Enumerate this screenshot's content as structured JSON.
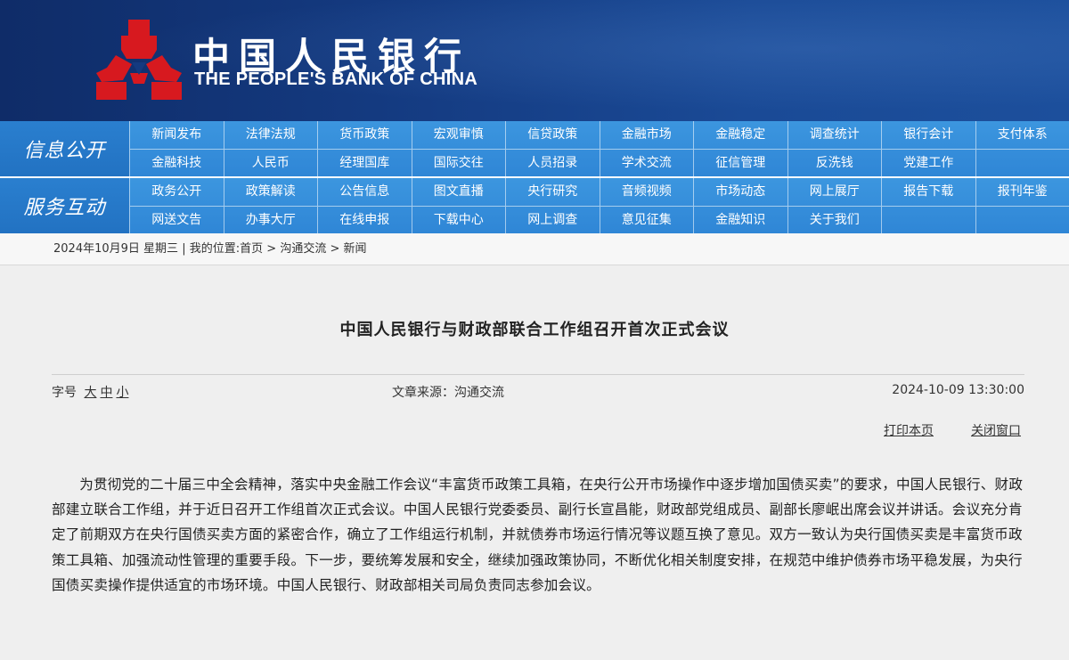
{
  "header": {
    "logo_cn": "中国人民银行",
    "logo_en": "THE PEOPLE'S BANK OF CHINA"
  },
  "nav": {
    "group1": {
      "label": "信息公开",
      "row1": [
        "新闻发布",
        "法律法规",
        "货币政策",
        "宏观审慎",
        "信贷政策",
        "金融市场",
        "金融稳定",
        "调查统计",
        "银行会计",
        "支付体系"
      ],
      "row2": [
        "金融科技",
        "人民币",
        "经理国库",
        "国际交往",
        "人员招录",
        "学术交流",
        "征信管理",
        "反洗钱",
        "党建工作",
        ""
      ]
    },
    "group2": {
      "label": "服务互动",
      "row1": [
        "政务公开",
        "政策解读",
        "公告信息",
        "图文直播",
        "央行研究",
        "音频视频",
        "市场动态",
        "网上展厅",
        "报告下载",
        "报刊年鉴"
      ],
      "row2": [
        "网送文告",
        "办事大厅",
        "在线申报",
        "下载中心",
        "网上调查",
        "意见征集",
        "金融知识",
        "关于我们",
        "",
        ""
      ]
    }
  },
  "breadcrumb": {
    "date": "2024年10月9日",
    "weekday": "星期三",
    "sep": "|",
    "prefix": "我的位置:",
    "home": "首页",
    "arrow": ">",
    "section": "沟通交流",
    "page": "新闻"
  },
  "article": {
    "title": "中国人民银行与财政部联合工作组召开首次正式会议",
    "font_size_label": "字号",
    "font_large": "大",
    "font_medium": "中",
    "font_small": "小",
    "source": "文章来源：沟通交流",
    "datetime": "2024-10-09 13:30:00",
    "print_label": "打印本页",
    "close_label": "关闭窗口",
    "body": "为贯彻党的二十届三中全会精神，落实中央金融工作会议“丰富货币政策工具箱，在央行公开市场操作中逐步增加国债买卖”的要求，中国人民银行、财政部建立联合工作组，并于近日召开工作组首次正式会议。中国人民银行党委委员、副行长宣昌能，财政部党组成员、副部长廖岷出席会议并讲话。会议充分肯定了前期双方在央行国债买卖方面的紧密合作，确立了工作组运行机制，并就债券市场运行情况等议题互换了意见。双方一致认为央行国债买卖是丰富货币政策工具箱、加强流动性管理的重要手段。下一步，要统筹发展和安全，继续加强政策协同，不断优化相关制度安排，在规范中维护债券市场平稳发展，为央行国债买卖操作提供适宜的市场环境。中国人民银行、财政部相关司局负责同志参加会议。"
  },
  "colors": {
    "header_bg": "#143a80",
    "nav_bg": "#3c96df",
    "emblem_red": "#d7191f"
  }
}
